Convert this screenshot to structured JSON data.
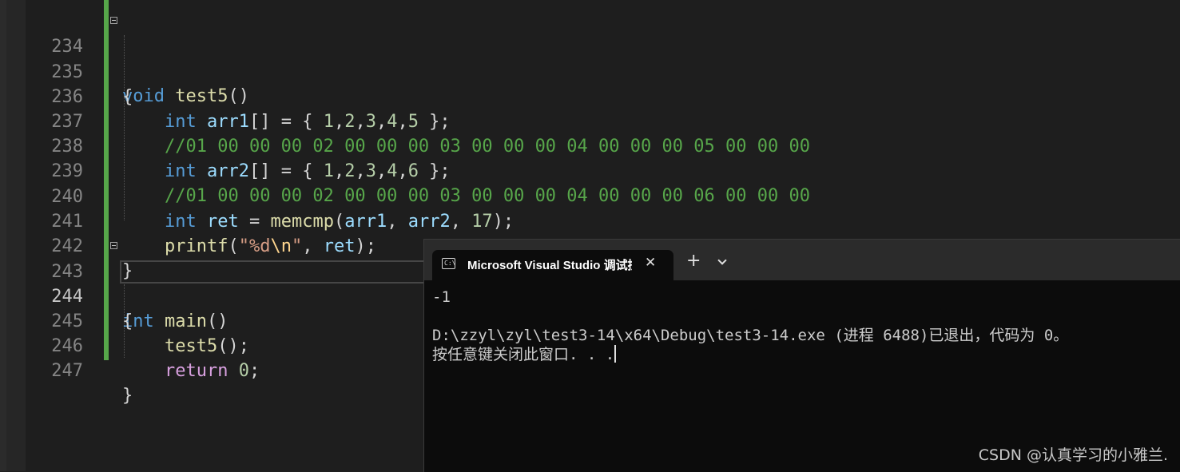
{
  "editor": {
    "lines": [
      {
        "num": "234"
      },
      {
        "num": "235"
      },
      {
        "num": "236"
      },
      {
        "num": "237"
      },
      {
        "num": "238"
      },
      {
        "num": "239"
      },
      {
        "num": "240"
      },
      {
        "num": "241"
      },
      {
        "num": "242"
      },
      {
        "num": "243"
      },
      {
        "num": "244"
      },
      {
        "num": "245"
      },
      {
        "num": "246"
      },
      {
        "num": "247"
      }
    ],
    "code": {
      "l234": {
        "kw": "void",
        "fn": "test5",
        "rest": "()"
      },
      "l235": "{",
      "l236": {
        "kw": "int",
        "var": "arr1",
        "p1": "[] = { ",
        "n1": "1",
        "n2": "2",
        "n3": "3",
        "n4": "4",
        "n5": "5",
        "p2": " };"
      },
      "l237": "//01 00 00 00 02 00 00 00 03 00 00 00 04 00 00 00 05 00 00 00",
      "l238": {
        "kw": "int",
        "var": "arr2",
        "p1": "[] = { ",
        "n1": "1",
        "n2": "2",
        "n3": "3",
        "n4": "4",
        "n5": "6",
        "p2": " };"
      },
      "l239": "//01 00 00 00 02 00 00 00 03 00 00 00 04 00 00 00 06 00 00 00",
      "l240": {
        "kw": "int",
        "var": "ret",
        "eq": " = ",
        "fn": "memcmp",
        "a1": "arr1",
        "a2": "arr2",
        "n": "17"
      },
      "l241": {
        "fn": "printf",
        "s1": "\"%d",
        "esc": "\\n",
        "s2": "\"",
        "var": "ret"
      },
      "l242": "}",
      "l243": {
        "kw": "int",
        "fn": "main",
        "rest": "()"
      },
      "l244": "{",
      "l245": {
        "fn": "test5",
        "rest": "();"
      },
      "l246": {
        "kw": "return",
        "num": "0",
        "rest": ";"
      },
      "l247": "}"
    },
    "colors": {
      "keyword": "#569cd6",
      "function": "#dcdcaa",
      "variable": "#9cdcfe",
      "number": "#b5cea8",
      "comment": "#57a64a",
      "string": "#d69d85"
    }
  },
  "terminal": {
    "tab_title": "Microsoft Visual Studio 调试控制台",
    "output": {
      "line1": "-1",
      "line2": "",
      "line3": "D:\\zzyl\\zyl\\test3-14\\x64\\Debug\\test3-14.exe (进程 6488)已退出，代码为 0。",
      "line4": "按任意键关闭此窗口. . ."
    },
    "icons": {
      "tab": "console-icon",
      "close": "close-icon",
      "new": "plus-icon",
      "menu": "chevron-down-icon"
    }
  },
  "watermark": "CSDN @认真学习的小雅兰."
}
